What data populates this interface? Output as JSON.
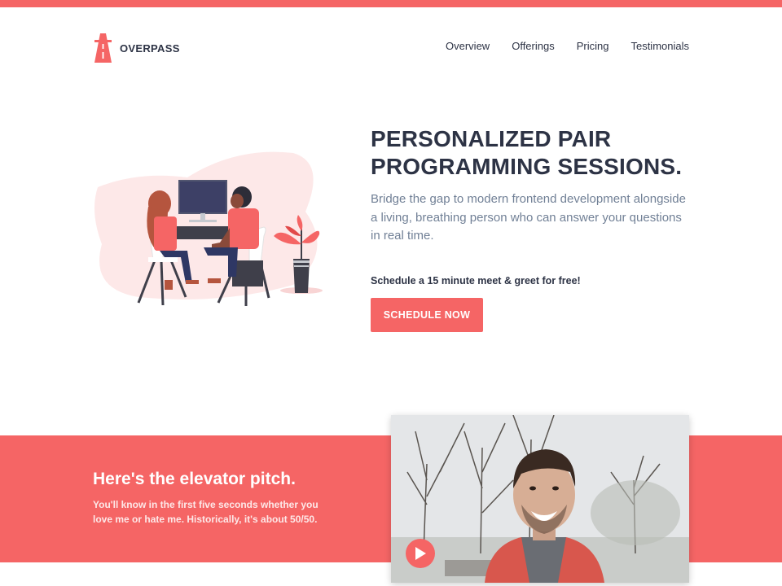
{
  "brand": {
    "name": "OVERPASS",
    "logo_icon": "highway-overpass-icon",
    "accent": "#f56565"
  },
  "nav": {
    "items": [
      {
        "label": "Overview"
      },
      {
        "label": "Offerings"
      },
      {
        "label": "Pricing"
      },
      {
        "label": "Testimonials"
      }
    ]
  },
  "hero": {
    "title": "PERSONALIZED PAIR PROGRAMMING SESSIONS.",
    "subtitle": "Bridge the gap to modern frontend development alongside a living, breathing person who can answer your questions in real time.",
    "cta_label": "Schedule a 15 minute meet & greet for free!",
    "button_label": "SCHEDULE NOW"
  },
  "pitch": {
    "title": "Here's the elevator pitch.",
    "subtitle": "You'll know in the first five seconds whether you love me or hate me. Historically, it's about 50/50.",
    "play_icon": "play-icon"
  }
}
